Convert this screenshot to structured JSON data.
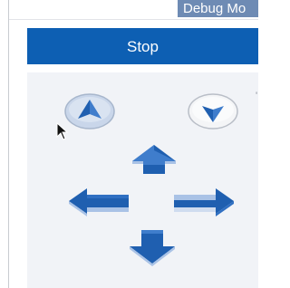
{
  "tab": {
    "label": "Debug Mo"
  },
  "stop_button": {
    "label": "Stop"
  },
  "controls": {
    "rotate_up_icon": "up-triangle-circle-icon",
    "rotate_down_icon": "down-triangle-circle-icon",
    "up_icon": "arrow-up-icon",
    "down_icon": "arrow-down-icon",
    "left_icon": "arrow-left-icon",
    "right_icon": "arrow-right-icon"
  },
  "colors": {
    "accent": "#0d5fb3",
    "arrow": "#1f5fb0",
    "arrow_highlight": "#a9c2e6",
    "tab": "#6e8bb4",
    "pad_background": "#f1f3f7"
  }
}
